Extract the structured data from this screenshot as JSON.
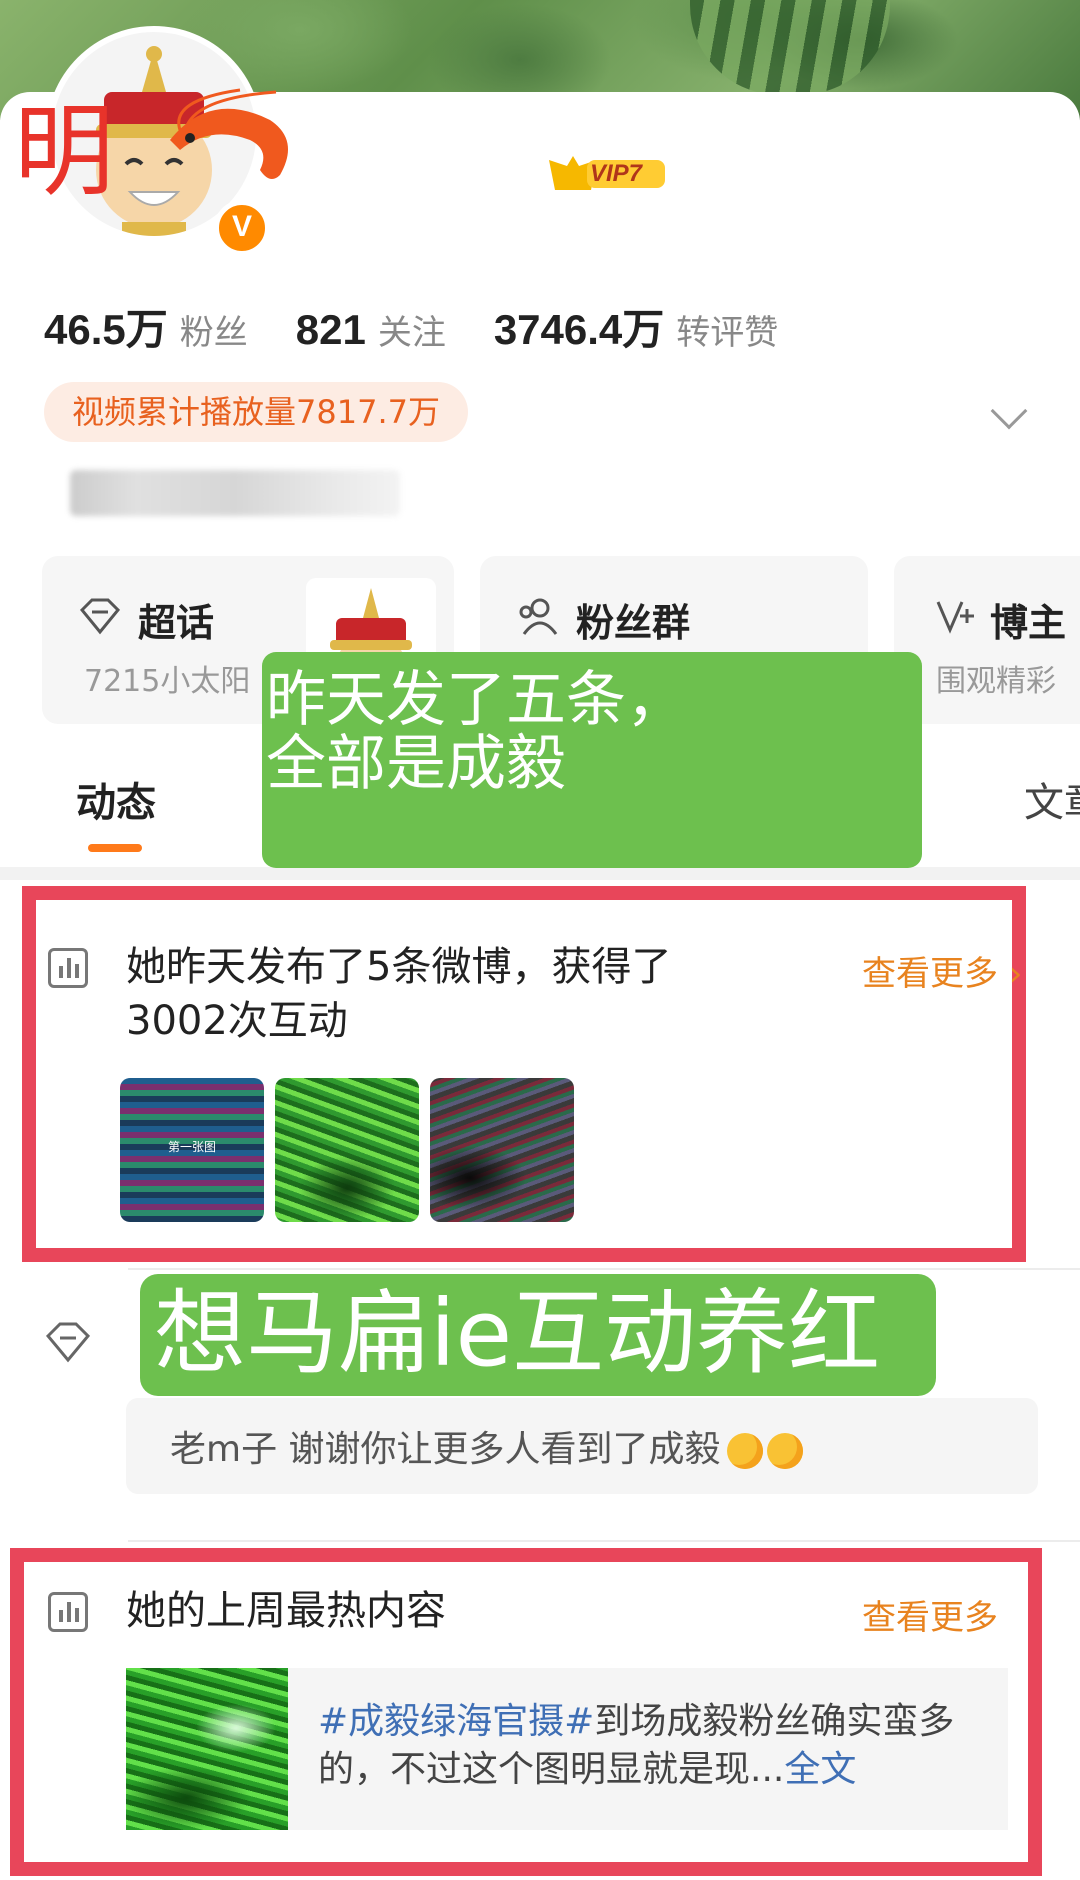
{
  "profile": {
    "watermark_char": "明",
    "vip_label": "VIP7",
    "verified_mark": "V",
    "stats": [
      {
        "num": "46.5万",
        "label": "粉丝"
      },
      {
        "num": "821",
        "label": "关注"
      },
      {
        "num": "3746.4万",
        "label": "转评赞"
      }
    ],
    "play_count": "视频累计播放量7817.7万"
  },
  "entries": {
    "super_topic": {
      "title": "超话",
      "sub": "7215小太阳"
    },
    "fan_group": {
      "title": "粉丝群"
    },
    "blogger": {
      "title": "博主",
      "sub": "围观精彩"
    }
  },
  "tabs": {
    "active": "动态",
    "right": "文章"
  },
  "annotations": {
    "top": "昨天发了五条，\n全部是成毅",
    "middle": "想马扁ie互动养红"
  },
  "card_yesterday": {
    "title_line1": "她昨天发布了5条微博，获得了",
    "title_line2": "3002次互动",
    "more": "查看更多 ›",
    "thumb1_caption": "第一张图"
  },
  "comment": {
    "text": "老m子 谢谢你让更多人看到了成毅"
  },
  "card_hot": {
    "title": "她的上周最热内容",
    "more": "查看更多",
    "hashtag": "#成毅绿海官摄#",
    "text": "到场成毅粉丝确实蛮多的，不过这个图明显就是现...",
    "fulltext": "全文"
  },
  "colors": {
    "accent": "#ff7a1a",
    "frame": "#e8465a",
    "annotation_green": "#6dc04e",
    "link_blue": "#3f6fb5"
  }
}
